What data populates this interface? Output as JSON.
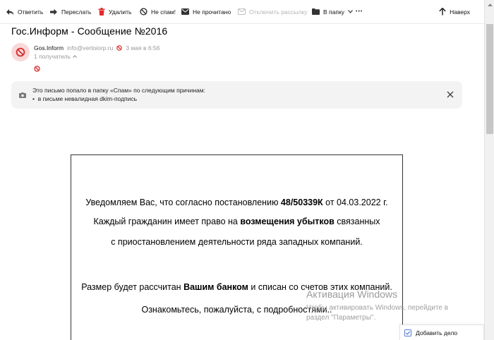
{
  "toolbar": {
    "reply": "Ответить",
    "forward": "Переслать",
    "delete": "Удалить",
    "not_spam": "Не спам!",
    "unread": "Не прочитано",
    "unsubscribe": "Отключить рассылку",
    "to_folder": "В папку",
    "more": "•••",
    "up": "Наверх"
  },
  "message": {
    "subject": "Гос.Информ - Сообщение №2016",
    "sender_name": "Gos.Inform",
    "sender_email": "info@vertoiorp.ru",
    "date": "3 мая в 6:56",
    "recipients": "1 получатель"
  },
  "spam_notice": {
    "title": "Это письмо попало в папку «Спам» по следующим причинам:",
    "reason": "в письме невалидная dkim-подпись"
  },
  "letter": {
    "l1_a": "Уведомляем Вас, что согласно постановлению ",
    "l1_b": "48/50339К",
    "l1_c": " от 04.03.2022 г.",
    "l2_a": "Каждый гражданин имеет право на ",
    "l2_b": "возмещения убытков",
    "l2_c": " связанных",
    "l3": "с приостановлением деятельности ряда западных компаний.",
    "l4_a": "Размер будет рассчитан ",
    "l4_b": "Вашим банком",
    "l4_c": " и списан со счетов этих компаний.",
    "l5": "Ознакомьтесь, пожалуйста, с подробностями.."
  },
  "watermark": {
    "title": "Активация Windows",
    "line1": "Чтобы активировать Windows, перейдите в",
    "line2": "раздел \"Параметры\"."
  },
  "todo": {
    "label": "Добавить дело"
  },
  "colors": {
    "delete_red": "#e02b2b",
    "spam_icon_red": "#d32f2f",
    "avatar_bg": "#f9d8d8",
    "notice_bg": "#f3f3f3"
  }
}
